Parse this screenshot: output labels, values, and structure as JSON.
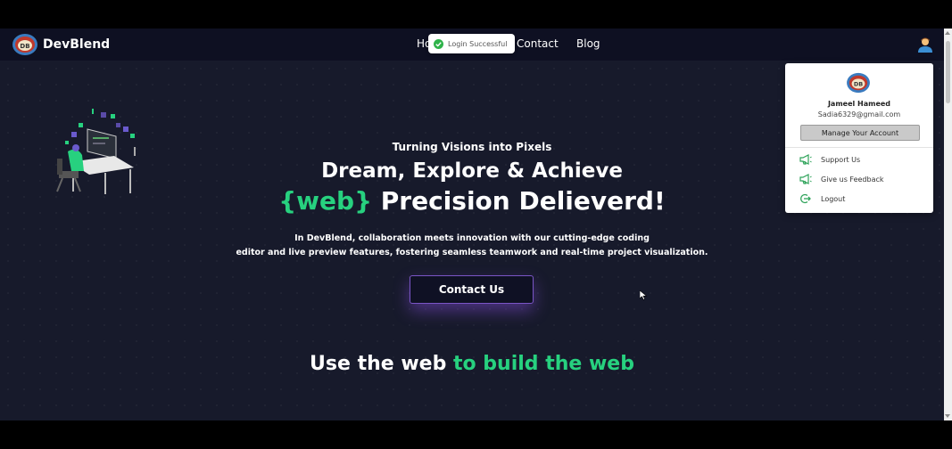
{
  "brand": {
    "name": "DevBlend",
    "logo_icon": "devblend-logo-icon"
  },
  "nav": {
    "home_label_visible": "Ho",
    "contact_label": "Contact",
    "blog_label": "Blog"
  },
  "toast": {
    "text": "Login Successful",
    "icon": "check-circle-icon",
    "color": "#2fb34a"
  },
  "hero": {
    "tagline": "Turning Visions into Pixels",
    "headline_line1": "Dream, Explore & Achieve",
    "headline_accent": "{web}",
    "headline_line2_rest": " Precision Delieverd!",
    "description_line1": "In DevBlend, collaboration meets innovation with our cutting-edge coding",
    "description_line2": "editor and live preview features, fostering seamless teamwork and real-time project visualization.",
    "cta_label": "Contact Us"
  },
  "section": {
    "title_plain": "Use the web ",
    "title_accent": "to build the web"
  },
  "account_menu": {
    "user_name": "Jameel Hameed",
    "email": "Sadia6329@gmail.com",
    "manage_label": "Manage Your Account",
    "items": [
      {
        "label": "Support Us",
        "icon": "megaphone-icon"
      },
      {
        "label": "Give us Feedback",
        "icon": "megaphone-icon"
      },
      {
        "label": "Logout",
        "icon": "logout-icon"
      }
    ]
  },
  "colors": {
    "accent": "#27d17f",
    "background": "#171a2b",
    "navbar": "#0e1022",
    "cta_border": "#7a55c6"
  }
}
